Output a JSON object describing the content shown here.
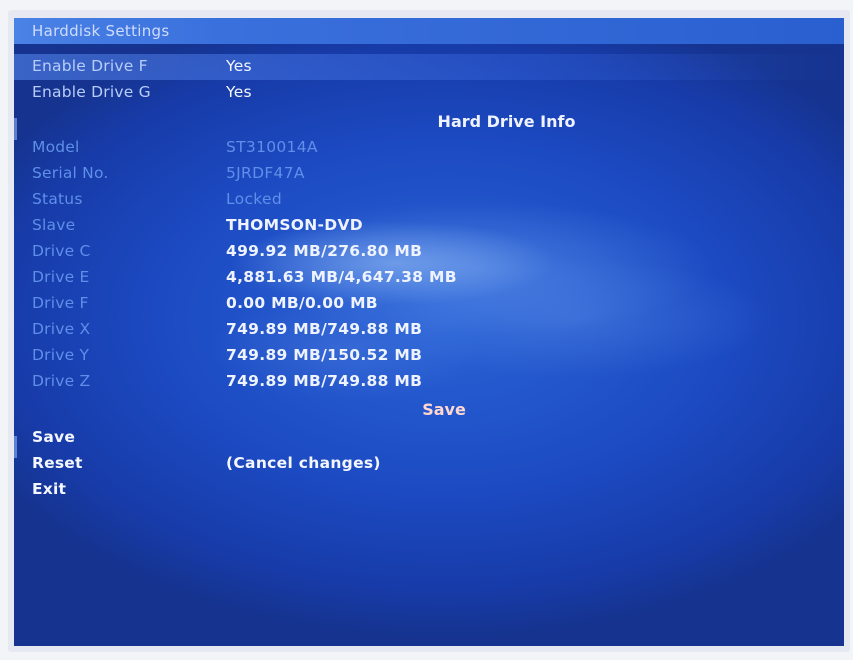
{
  "window": {
    "title": "Harddisk Settings"
  },
  "options": [
    {
      "label": "Enable Drive F",
      "value": "Yes"
    },
    {
      "label": "Enable Drive G",
      "value": "Yes"
    }
  ],
  "info": {
    "heading": "Hard Drive Info",
    "rows": [
      {
        "label": "Model",
        "value": "ST310014A"
      },
      {
        "label": "Serial No.",
        "value": "5JRDF47A"
      },
      {
        "label": "Status",
        "value": "Locked"
      },
      {
        "label": "Slave",
        "value": "THOMSON-DVD"
      },
      {
        "label": "Drive C",
        "value": "499.92 MB/276.80 MB"
      },
      {
        "label": "Drive E",
        "value": "4,881.63 MB/4,647.38 MB"
      },
      {
        "label": "Drive F",
        "value": "0.00 MB/0.00 MB"
      },
      {
        "label": "Drive X",
        "value": "749.89 MB/749.88 MB"
      },
      {
        "label": "Drive Y",
        "value": "749.89 MB/150.52 MB"
      },
      {
        "label": "Drive Z",
        "value": "749.89 MB/749.88 MB"
      }
    ],
    "save_hint": "Save"
  },
  "actions": {
    "save_label": "Save",
    "reset_label": "Reset",
    "reset_hint": "(Cancel changes)",
    "exit_label": "Exit"
  },
  "colors": {
    "background": "#1c4ac2",
    "titlebar": "#3a70dc",
    "dim_label": "#5f8fe8",
    "bright_text": "#eef3ff",
    "hint_text": "#ffd7d2"
  }
}
